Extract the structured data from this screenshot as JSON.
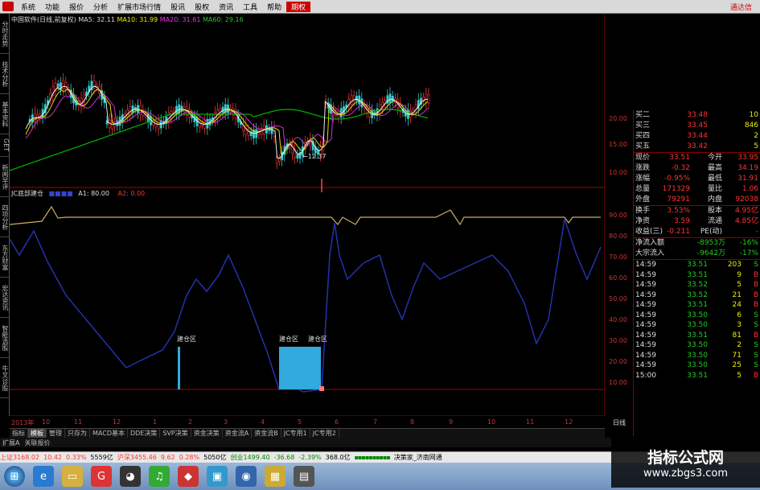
{
  "menu": {
    "items": [
      "系统",
      "功能",
      "报价",
      "分析",
      "扩展市场行情",
      "股讯",
      "股权",
      "资讯",
      "工具",
      "帮助"
    ],
    "highlight": "期权",
    "right": "通达信"
  },
  "left_tabs": [
    "分时走势",
    "技术分析",
    "基本资料",
    "GET",
    "新闻早评",
    "四项分析",
    "东方财富",
    "宏达资讯",
    "智能选股",
    "牛叉诊股"
  ],
  "kline_legend": {
    "title": "中国软件(日线,前复权)",
    "ma5": "MA5: 32.11",
    "ma10": "MA10: 31.99",
    "ma20": "MA20: 31.61",
    "ma60": "MA60: 29.16"
  },
  "low_marker": "←12.37",
  "indicator_legend": {
    "name": "JC底部建仓",
    "a1": "A1: 80.00",
    "a2": "A2: 0.00"
  },
  "zone_labels": [
    "建仓区",
    "建仓区",
    "建仓区"
  ],
  "price_axis": [
    "20.00",
    "15.00",
    "10.00"
  ],
  "ind_axis": [
    "90.00",
    "80.00",
    "70.00",
    "60.00",
    "50.00",
    "40.00",
    "30.00",
    "20.00",
    "10.00"
  ],
  "x_axis": [
    "2013年",
    "10",
    "11",
    "12",
    "1",
    "2",
    "3",
    "4",
    "5",
    "6",
    "7",
    "8",
    "9",
    "10",
    "11",
    "12"
  ],
  "period": "日线",
  "buy_orders": [
    {
      "label": "买二",
      "price": "33.48",
      "vol": "10"
    },
    {
      "label": "买三",
      "price": "33.45",
      "vol": "846"
    },
    {
      "label": "买四",
      "price": "33.44",
      "vol": "2"
    },
    {
      "label": "买五",
      "price": "33.42",
      "vol": "5"
    }
  ],
  "quote": [
    {
      "l1": "现价",
      "v1": "33.51",
      "l2": "今开",
      "v2": "33.95"
    },
    {
      "l1": "涨跌",
      "v1": "-0.32",
      "l2": "最高",
      "v2": "34.19"
    },
    {
      "l1": "涨幅",
      "v1": "-0.95%",
      "l2": "最低",
      "v2": "31.91"
    },
    {
      "l1": "总量",
      "v1": "171329",
      "l2": "量比",
      "v2": "1.06"
    },
    {
      "l1": "外盘",
      "v1": "79291",
      "l2": "内盘",
      "v2": "92038"
    }
  ],
  "fundamentals": [
    {
      "l1": "换手",
      "v1": "3.53%",
      "l2": "股本",
      "v2": "4.95亿"
    },
    {
      "l1": "净资",
      "v1": "3.59",
      "l2": "流通",
      "v2": "4.85亿"
    },
    {
      "l1": "收益(三)",
      "v1": "-0.211",
      "l2": "PE(动)",
      "v2": "-"
    }
  ],
  "flows": [
    {
      "label": "净流入额",
      "v1": "-8953万",
      "v2": "-16%"
    },
    {
      "label": "大宗流入",
      "v1": "-9642万",
      "v2": "-17%"
    }
  ],
  "ticks": [
    {
      "t": "14:59",
      "p": "33.51",
      "v": "203",
      "s": "S"
    },
    {
      "t": "14:59",
      "p": "33.51",
      "v": "9",
      "s": "B"
    },
    {
      "t": "14:59",
      "p": "33.52",
      "v": "5",
      "s": "B"
    },
    {
      "t": "14:59",
      "p": "33.52",
      "v": "21",
      "s": "B"
    },
    {
      "t": "14:59",
      "p": "33.51",
      "v": "24",
      "s": "B"
    },
    {
      "t": "14:59",
      "p": "33.50",
      "v": "6",
      "s": "S"
    },
    {
      "t": "14:59",
      "p": "33.50",
      "v": "3",
      "s": "S"
    },
    {
      "t": "14:59",
      "p": "33.51",
      "v": "81",
      "s": "B"
    },
    {
      "t": "14:59",
      "p": "33.50",
      "v": "2",
      "s": "S"
    },
    {
      "t": "14:59",
      "p": "33.50",
      "v": "71",
      "s": "S"
    },
    {
      "t": "14:59",
      "p": "33.50",
      "v": "25",
      "s": "S"
    },
    {
      "t": "15:00",
      "p": "33.51",
      "v": "5",
      "s": "B"
    }
  ],
  "bottom_tabs": [
    "指标",
    "模板",
    "管理",
    "只存为",
    "MACD基本",
    "DDE决策",
    "SVP决策",
    "资金决策",
    "资金流A",
    "资金流B",
    "JC专用1",
    "JC专用2"
  ],
  "bottom_tabs2": [
    "扩展A",
    "关联报价"
  ],
  "status": {
    "sh": "上证3168.02",
    "sh_chg": "10.42",
    "sh_pct": "0.33%",
    "sh_vol": "5559亿",
    "sz": "沪深3455.46",
    "sz_chg": "9.62",
    "sz_pct": "0.28%",
    "sz_vol": "5050亿",
    "cy": "创业1499.40",
    "cy_chg": "-36.68",
    "cy_pct": "-2.39%",
    "cy_vol": "368.0亿",
    "right": "决策家_济南网通"
  },
  "watermark": {
    "title": "指标公式网",
    "url": "www.zbgs3.com"
  },
  "colors": {
    "ma5": "#ffffff",
    "ma10": "#ffff00",
    "ma20": "#ff00ff",
    "ma60": "#00cc00",
    "indicator": "#2233aa",
    "a1": "#c8b060",
    "zone": "#33aadd"
  }
}
